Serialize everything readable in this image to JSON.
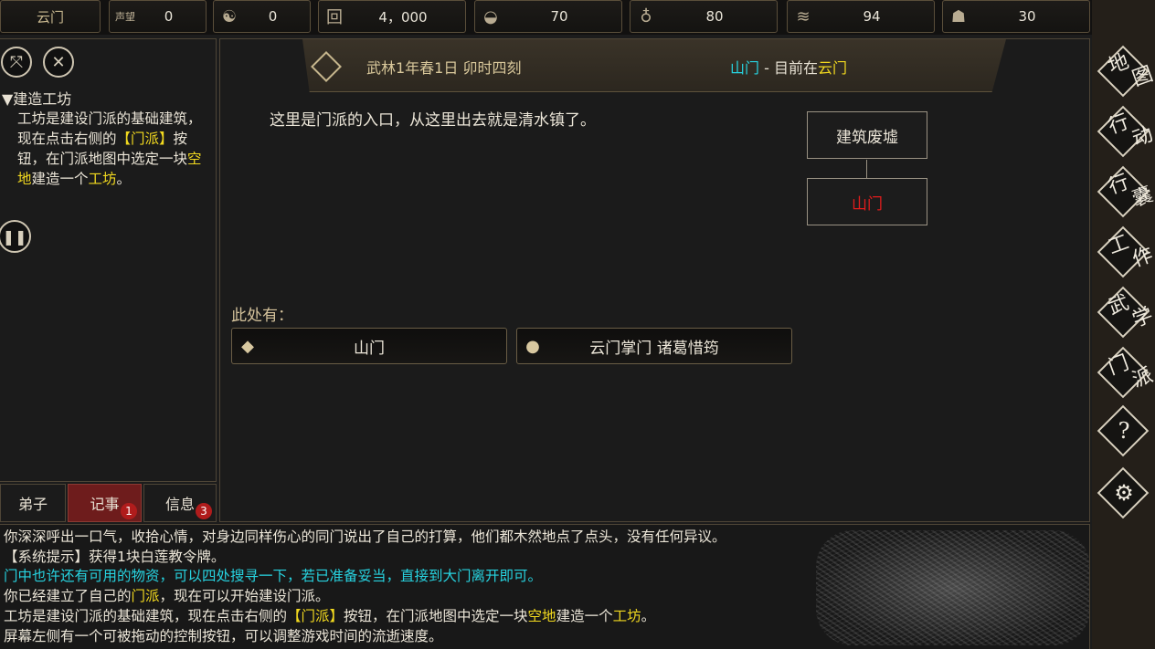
{
  "topbar": {
    "sect_name": "云门",
    "resources": [
      {
        "icon": "prestige-icon",
        "glyph": "声望",
        "value": "0"
      },
      {
        "icon": "yinyang-icon",
        "glyph": "☯",
        "value": "0"
      },
      {
        "icon": "coin-icon",
        "glyph": "回",
        "value": "4，000"
      },
      {
        "icon": "food-icon",
        "glyph": "◒",
        "value": "70"
      },
      {
        "icon": "gourd-icon",
        "glyph": "♁",
        "value": "80"
      },
      {
        "icon": "wood-icon",
        "glyph": "≋",
        "value": "94"
      },
      {
        "icon": "ore-icon",
        "glyph": "☗",
        "value": "30"
      }
    ]
  },
  "left": {
    "task_title": "▼建造工坊",
    "task_parts": [
      {
        "text": "工坊是建设门派的基础建筑，现在点击右侧的",
        "color": "white"
      },
      {
        "text": "【门派】",
        "color": "yellow"
      },
      {
        "text": "按钮，在门派地图中选定一块",
        "color": "white"
      },
      {
        "text": "空地",
        "color": "yellow"
      },
      {
        "text": "建造一个",
        "color": "white"
      },
      {
        "text": "工坊",
        "color": "yellow"
      },
      {
        "text": "。",
        "color": "white"
      }
    ],
    "tabs": [
      {
        "label": "弟子",
        "badge": ""
      },
      {
        "label": "记事",
        "badge": "1"
      },
      {
        "label": "信息",
        "badge": "3"
      }
    ]
  },
  "center": {
    "date": "武林1年春1日 卯时四刻",
    "location_name": "山门",
    "location_sep": " - ",
    "location_prefix": "目前在",
    "location_sect": "云门",
    "description": "这里是门派的入口，从这里出去就是清水镇了。",
    "map": {
      "parent": "建筑废墟",
      "current": "山门"
    },
    "here_label": "此处有：",
    "entities": [
      {
        "icon": "box-icon",
        "label": "山门"
      },
      {
        "icon": "person-icon",
        "label": "云门掌门 诸葛惜筠"
      }
    ]
  },
  "nav": [
    {
      "label": "地图",
      "icon": "map-nav"
    },
    {
      "label": "行动",
      "icon": "action-nav"
    },
    {
      "label": "行囊",
      "icon": "bag-nav"
    },
    {
      "label": "工作",
      "icon": "work-nav"
    },
    {
      "label": "武学",
      "icon": "martial-nav"
    },
    {
      "label": "门派",
      "icon": "sect-nav"
    },
    {
      "label": "?",
      "icon": "help-icon"
    },
    {
      "label": "⚙",
      "icon": "settings-icon"
    }
  ],
  "log": [
    [
      {
        "text": "你深深呼出一口气，收拾心情，对身边同样伤心的同门说出了自己的打算，他们都木然地点了点头，没有任何异议。",
        "color": "white"
      }
    ],
    [
      {
        "text": "【系统提示】获得1块白莲教令牌。",
        "color": "white"
      }
    ],
    [
      {
        "text": "门中也许还有可用的物资，可以四处搜寻一下，若已准备妥当，直接到大门离开即可。",
        "color": "cyan"
      }
    ],
    [
      {
        "text": "你已经建立了自己的",
        "color": "white"
      },
      {
        "text": "门派",
        "color": "yellow"
      },
      {
        "text": "，现在可以开始建设门派。",
        "color": "white"
      }
    ],
    [
      {
        "text": "工坊是建设门派的基础建筑，现在点击右侧的",
        "color": "white"
      },
      {
        "text": "【门派】",
        "color": "yellow"
      },
      {
        "text": "按钮，在门派地图中选定一块",
        "color": "white"
      },
      {
        "text": "空地",
        "color": "yellow"
      },
      {
        "text": "建造一个",
        "color": "white"
      },
      {
        "text": "工坊",
        "color": "yellow"
      },
      {
        "text": "。",
        "color": "white"
      }
    ],
    [
      {
        "text": "屏幕左侧有一个可被拖动的控制按钮，可以调整游戏时间的流逝速度。",
        "color": "white"
      }
    ]
  ],
  "colors": {
    "yellow": "#f2d91f",
    "cyan": "#27d3e0",
    "red": "#e21c1c",
    "white": "#ece6d8"
  }
}
